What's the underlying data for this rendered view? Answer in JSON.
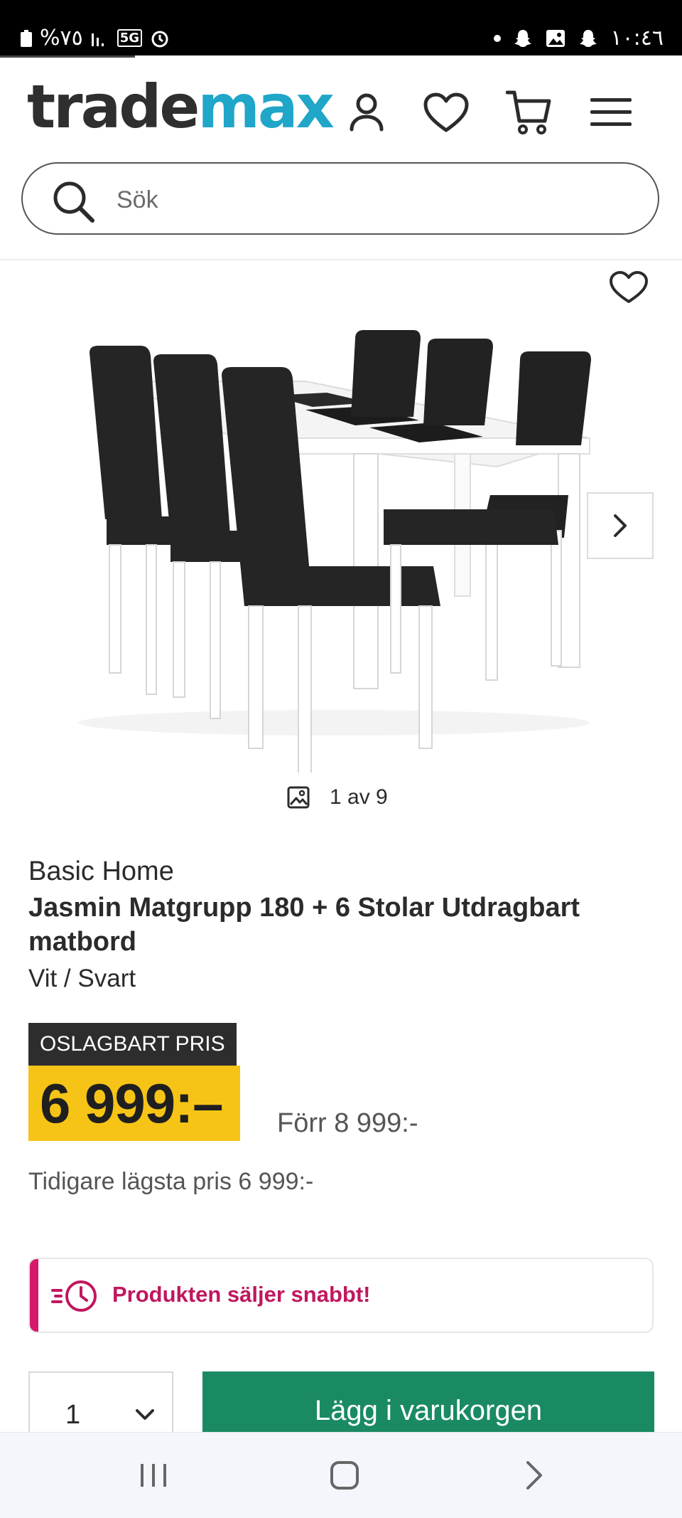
{
  "status_bar": {
    "battery": "%٧٥",
    "network": "5G",
    "time": "١٠:٤٦"
  },
  "header": {
    "logo_part1": "trade",
    "logo_part2": "max",
    "icons": [
      "account-icon",
      "heart-icon",
      "cart-icon",
      "menu-icon"
    ]
  },
  "search": {
    "placeholder": "Sök"
  },
  "gallery": {
    "counter": "1 av 9"
  },
  "product": {
    "brand": "Basic Home",
    "title": "Jasmin Matgrupp 180 + 6 Stolar Utdragbart matbord",
    "variant": "Vit / Svart",
    "badge": "OSLAGBART PRIS",
    "price": "6 999:–",
    "old_price": "Förr 8 999:-",
    "lowest_price": "Tidigare lägsta pris 6 999:-"
  },
  "alert": {
    "text": "Produkten säljer snabbt!"
  },
  "purchase": {
    "quantity": "1",
    "add_to_cart": "Lägg i varukorgen"
  },
  "colors": {
    "logo_accent": "#1fa6c9",
    "price_bg": "#f6c416",
    "alert_accent": "#d6196a",
    "cart_button": "#1a8a63"
  }
}
